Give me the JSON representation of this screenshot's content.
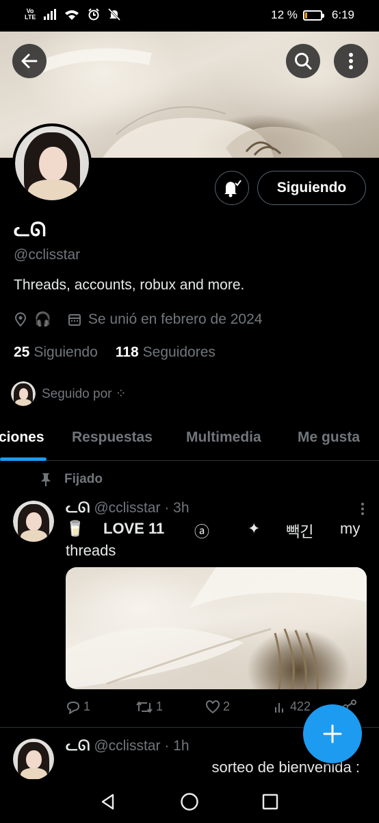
{
  "status_bar": {
    "network_label": "Vo LTE",
    "battery_text": "12 %",
    "battery_level": 0.12,
    "battery_color": "#ff9800",
    "time": "6:19",
    "icons": [
      "signal-icon",
      "wifi-icon",
      "alarm-icon",
      "mute-icon",
      "battery-icon"
    ]
  },
  "header": {
    "back_icon": "arrow-left-icon",
    "search_icon": "search-icon",
    "more_icon": "more-vertical-icon"
  },
  "profile": {
    "display_name": "ᓚᘏ",
    "handle": "@cclisstar",
    "bio": "Threads, accounts, robux and more.",
    "location_icon": "location-pin-icon",
    "location_emoji": "🎧",
    "joined": "Se unió en febrero de 2024",
    "following_count": "25",
    "following_label": "Siguiendo",
    "followers_count": "118",
    "followers_label": "Seguidores",
    "followed_by": "Seguido por ⁘",
    "follow_button": "Siguiendo",
    "notify_icon": "bell-check-icon"
  },
  "tabs": [
    {
      "label": "ciones",
      "active": true
    },
    {
      "label": "Respuestas",
      "active": false
    },
    {
      "label": "Multimedia",
      "active": false
    },
    {
      "label": "Me gusta",
      "active": false
    }
  ],
  "posts": [
    {
      "pinned_label": "Fijado",
      "name": "ᓚᘏ",
      "handle_time": "@cclisstar · 3h",
      "text_line1": [
        "🥛",
        "LOVE 11",
        "ⓐ",
        "✦",
        "빽긴",
        "my"
      ],
      "text_line2": "threads",
      "replies": "1",
      "reposts": "1",
      "likes": "2",
      "views": "422"
    },
    {
      "name": "ᓚᘏ",
      "handle_time": "@cclisstar · 1h",
      "text": "sorteo de bienvenida :"
    }
  ],
  "fab_icon": "plus-icon",
  "accent_color": "#1d9bf0",
  "nav": [
    "back-triangle-icon",
    "home-circle-icon",
    "recents-square-icon"
  ]
}
